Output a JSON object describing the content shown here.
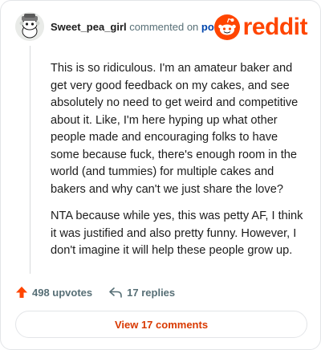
{
  "comment": {
    "username": "Sweet_pea_girl",
    "verb": "commented on",
    "post_link": "post",
    "paragraphs": [
      "This is so ridiculous. I'm an amateur baker and get very good feedback on my cakes, and see absolutely no need to get weird and competitive about it. Like, I'm here hyping up what other people made and encouraging folks to have some because fuck, there's enough room in the world (and tummies) for multiple cakes and bakers and why can't we just share the love?",
      "NTA because while yes, this was petty AF, I think it was justified and also pretty funny. However, I don't imagine it will help these people grow up."
    ]
  },
  "brand": {
    "name": "reddit",
    "color": "#ff4500"
  },
  "actions": {
    "upvotes_label": "498 upvotes",
    "replies_label": "17 replies"
  },
  "footer": {
    "view_comments_label": "View 17 comments"
  },
  "icons": {
    "upvote": "upvote-arrow-icon",
    "reply": "reply-arrow-icon",
    "avatar": "snoo-avatar-icon",
    "logo": "reddit-snoo-icon"
  },
  "colors": {
    "accent": "#d93900",
    "upvote": "#ff4500",
    "link": "#0045ac",
    "muted": "#576f76"
  }
}
